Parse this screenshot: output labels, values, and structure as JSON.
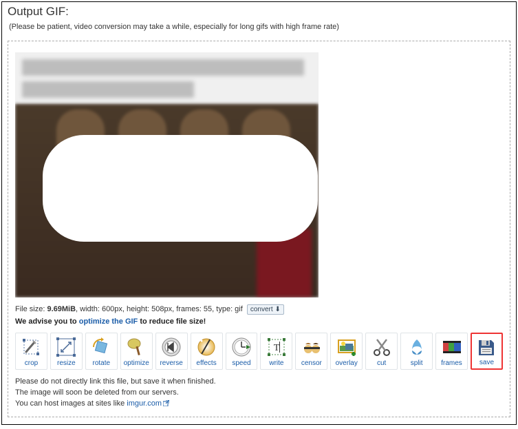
{
  "header": {
    "title": "Output GIF:",
    "note": "(Please be patient, video conversion may take a while, especially for long gifs with high frame rate)"
  },
  "file": {
    "prefix": "File size: ",
    "size": "9.69MiB",
    "dims": ", width: 600px, height: 508px, frames: 55, type: gif",
    "convert_label": "convert"
  },
  "advise": {
    "pre": "We advise you to ",
    "link": "optimize the GIF",
    "post": " to reduce file size!"
  },
  "tools": {
    "crop": "crop",
    "resize": "resize",
    "rotate": "rotate",
    "optimize": "optimize",
    "reverse": "reverse",
    "effects": "effects",
    "speed": "speed",
    "write": "write",
    "censor": "censor",
    "overlay": "overlay",
    "cut": "cut",
    "split": "split",
    "frames": "frames",
    "save": "save"
  },
  "bottom": {
    "l1": "Please do not directly link this file, but save it when finished.",
    "l2": "The image will soon be deleted from our servers.",
    "l3_pre": "You can host images at sites like ",
    "l3_link": "imgur.com"
  }
}
